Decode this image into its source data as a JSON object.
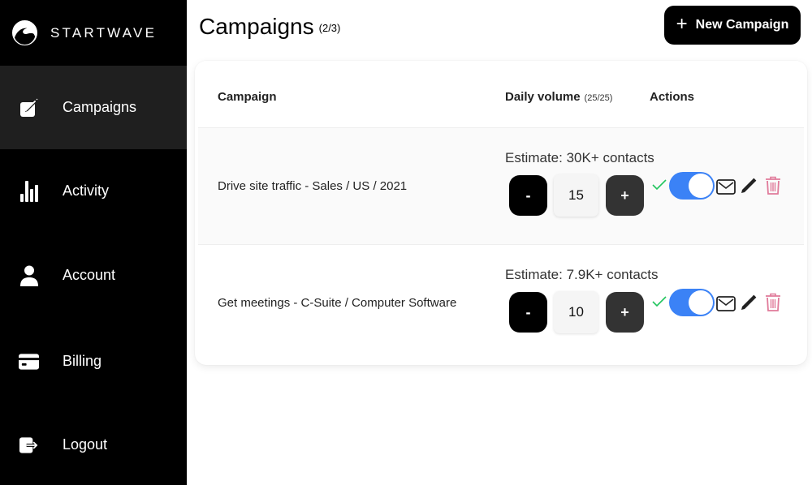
{
  "brand": {
    "name": "STARTWAVE",
    "logo_icon": "wave-icon"
  },
  "sidebar": {
    "items": [
      {
        "label": "Campaigns",
        "icon": "edit-square-icon",
        "active": true
      },
      {
        "label": "Activity",
        "icon": "bar-chart-icon",
        "active": false
      },
      {
        "label": "Account",
        "icon": "user-icon",
        "active": false
      },
      {
        "label": "Billing",
        "icon": "credit-card-icon",
        "active": false
      },
      {
        "label": "Logout",
        "icon": "logout-icon",
        "active": false
      }
    ]
  },
  "header": {
    "title": "Campaigns",
    "count": "(2/3)",
    "new_button_label": "New Campaign",
    "new_button_icon": "plus-icon"
  },
  "table": {
    "columns": {
      "campaign": "Campaign",
      "daily_volume": "Daily volume",
      "daily_volume_sub": "(25/25)",
      "actions": "Actions"
    },
    "rows": [
      {
        "name": "Drive site traffic - Sales / US / 2021",
        "estimate": "Estimate: 30K+ contacts",
        "volume": "15",
        "minus_label": "-",
        "plus_label": "+",
        "enabled": true
      },
      {
        "name": "Get meetings - C-Suite / Computer Software",
        "estimate": "Estimate: 7.9K+ contacts",
        "volume": "10",
        "minus_label": "-",
        "plus_label": "+",
        "enabled": true
      }
    ]
  },
  "colors": {
    "toggle_on": "#3b82f6",
    "check": "#22c55e",
    "delete": "#e07a9a",
    "sidebar_bg": "#000000",
    "sidebar_active": "#1f1f1f"
  }
}
